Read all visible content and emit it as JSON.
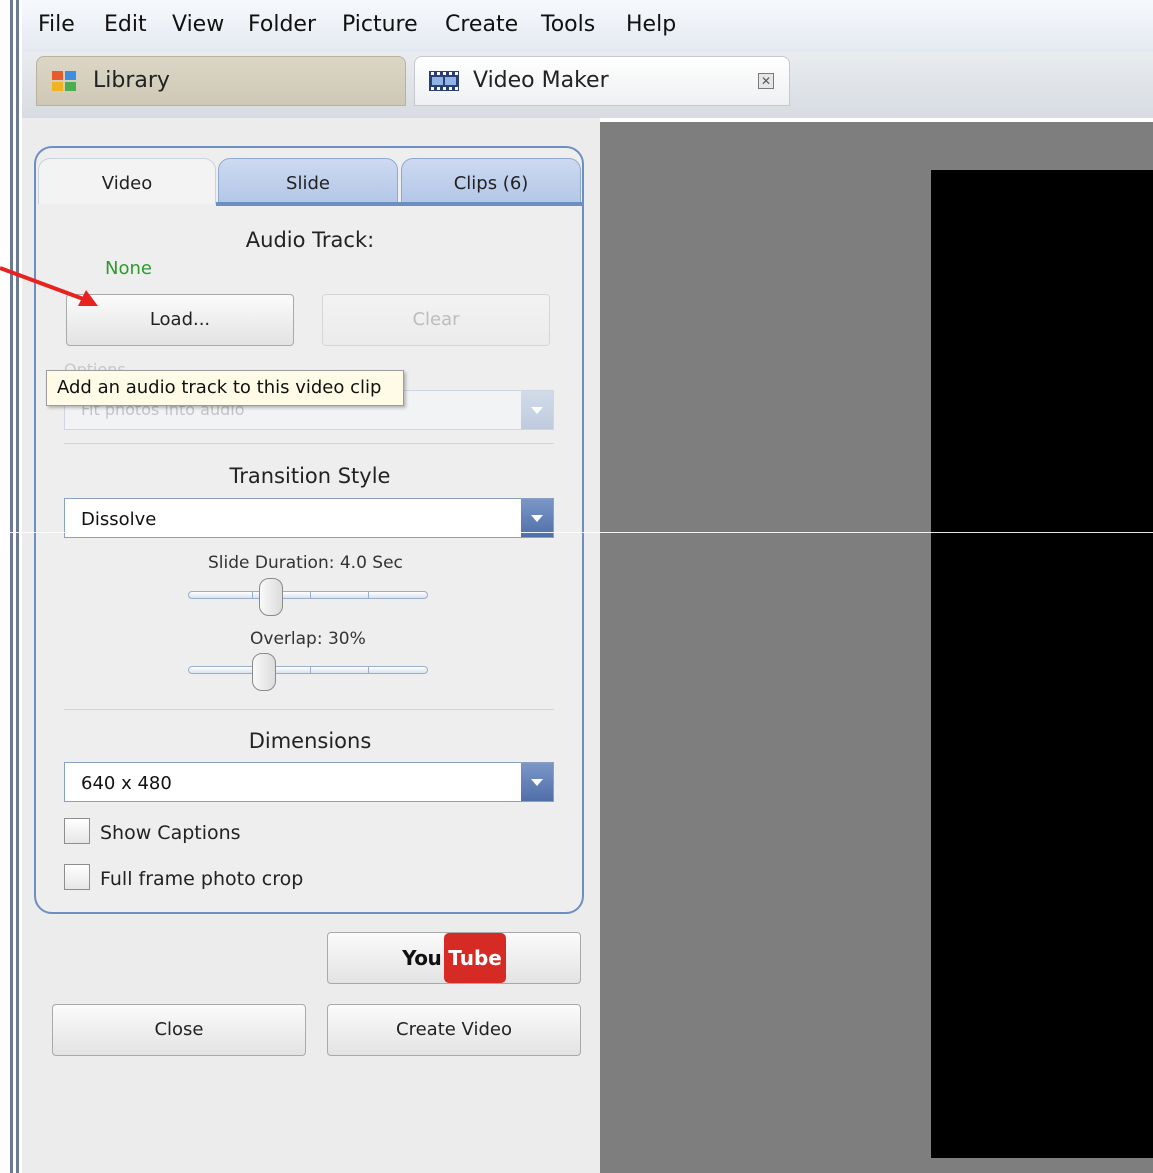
{
  "menubar": {
    "items": [
      "File",
      "Edit",
      "View",
      "Folder",
      "Picture",
      "Create",
      "Tools",
      "Help"
    ]
  },
  "tabs": {
    "library_label": "Library",
    "videomaker_label": "Video Maker"
  },
  "panel": {
    "subtabs": [
      "Video",
      "Slide",
      "Clips (6)"
    ],
    "audio_track": {
      "title": "Audio Track:",
      "current": "None",
      "load_label": "Load...",
      "clear_label": "Clear",
      "options_label": "Options",
      "options_value": "Fit photos into audio"
    },
    "tooltip": "Add an audio track to this video clip",
    "transition": {
      "title": "Transition Style",
      "value": "Dissolve"
    },
    "slide_duration": {
      "label": "Slide Duration: 4.0 Sec",
      "value_fraction": 0.3
    },
    "overlap": {
      "label": "Overlap: 30%",
      "value_fraction": 0.3
    },
    "dimensions": {
      "title": "Dimensions",
      "value": "640 x 480"
    },
    "checkboxes": {
      "show_captions": "Show Captions",
      "full_frame": "Full frame photo crop"
    },
    "youtube": {
      "you": "You",
      "tube": "Tube"
    },
    "close_label": "Close",
    "create_label": "Create Video"
  },
  "colors": {
    "accent_blue": "#6d8ec0",
    "none_green": "#2e9a2e",
    "annotation_red": "#e8231f",
    "preview_gray": "#7e7e7e"
  }
}
